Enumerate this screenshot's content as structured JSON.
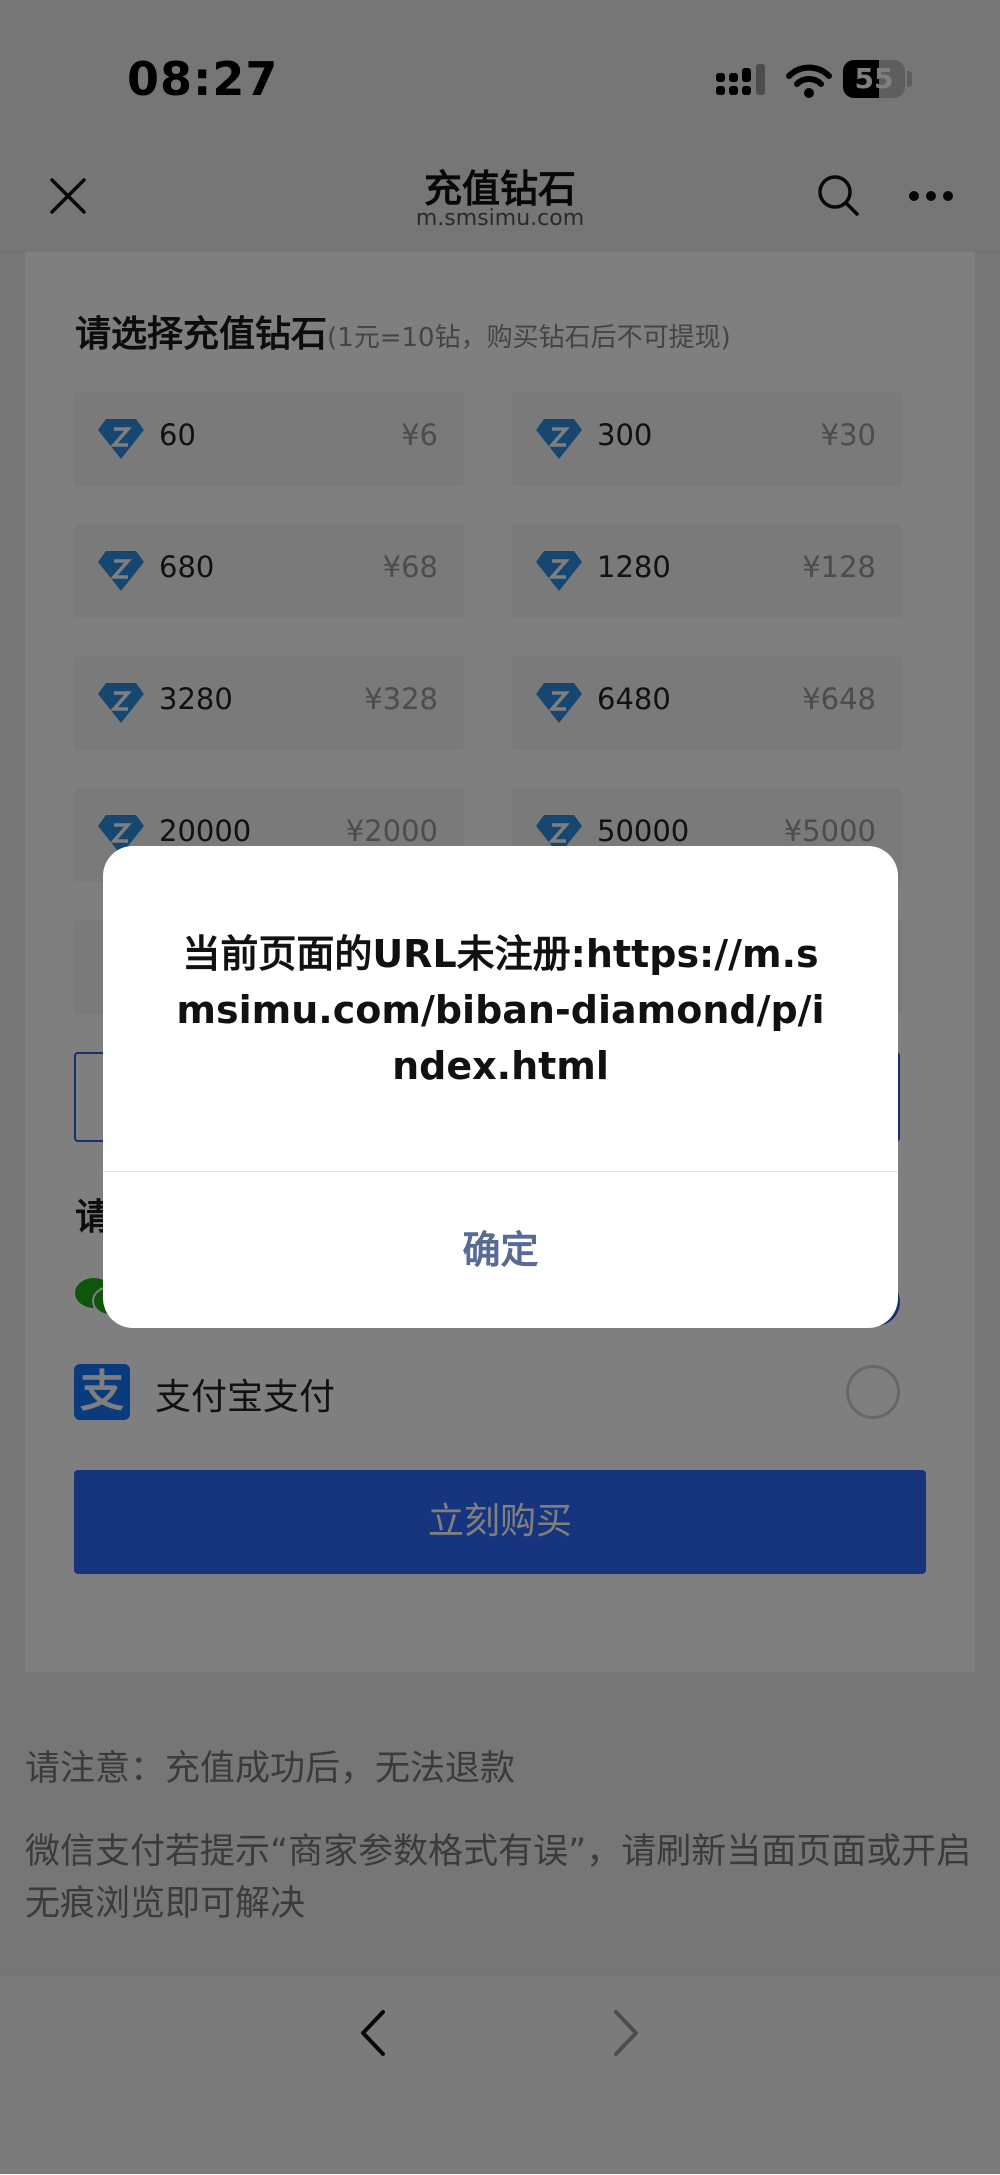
{
  "status_bar": {
    "time": "08:27",
    "battery": "55"
  },
  "nav": {
    "title": "充值钻石",
    "subtitle": "m.smsimu.com"
  },
  "diamond_section": {
    "title": "请选择充值钻石",
    "note": "(1元=10钻，购买钻石后不可提现)"
  },
  "options": [
    {
      "amount": "60",
      "price": "¥6"
    },
    {
      "amount": "300",
      "price": "¥30"
    },
    {
      "amount": "680",
      "price": "¥68"
    },
    {
      "amount": "1280",
      "price": "¥128"
    },
    {
      "amount": "3280",
      "price": "¥328"
    },
    {
      "amount": "6480",
      "price": "¥648"
    },
    {
      "amount": "20000",
      "price": "¥2000"
    },
    {
      "amount": "50000",
      "price": "¥5000"
    }
  ],
  "payment": {
    "title_visible": "请",
    "alipay_label": "支付宝支付",
    "alipay_icon_glyph": "支",
    "buy_label": "立刻购买"
  },
  "notices": {
    "line1": "请注意：充值成功后，无法退款",
    "line2": "微信支付若提示“商家参数格式有误”，请刷新当面页面或开启无痕浏览即可解决"
  },
  "dialog": {
    "message": "当前页面的URL未注册:https://m.smsimu.com/biban-diamond/p/index.html",
    "confirm_label": "确定"
  },
  "colors": {
    "accent": "#2f6bff",
    "dialog_button": "#576b95",
    "gem": "#2f8ee0"
  }
}
